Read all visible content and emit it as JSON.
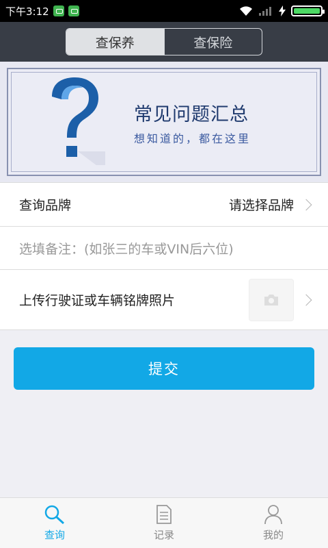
{
  "status_bar": {
    "time": "下午3:12",
    "battery_level": 1.0,
    "icons": [
      "notification-app-icon",
      "notification-app-icon",
      "wifi-icon",
      "signal-icon",
      "charging-icon",
      "battery-icon"
    ]
  },
  "header": {
    "tabs": [
      {
        "label": "查保养",
        "active": true
      },
      {
        "label": "查保险",
        "active": false
      }
    ]
  },
  "banner": {
    "title": "常见问题汇总",
    "subtitle": "想知道的，都在这里",
    "icon": "question-mark-icon"
  },
  "form": {
    "brand_label": "查询品牌",
    "brand_value": "请选择品牌",
    "note_placeholder": "选填备注：(如张三的车或VIN后六位)",
    "upload_label": "上传行驶证或车辆铭牌照片",
    "upload_icon": "camera-icon"
  },
  "submit_label": "提交",
  "bottom_nav": {
    "items": [
      {
        "label": "查询",
        "icon": "search-icon",
        "active": true
      },
      {
        "label": "记录",
        "icon": "document-icon",
        "active": false
      },
      {
        "label": "我的",
        "icon": "person-icon",
        "active": false
      }
    ]
  },
  "colors": {
    "accent": "#12a8e6",
    "header_bg": "#383d46",
    "banner_title": "#1f3a6e"
  }
}
